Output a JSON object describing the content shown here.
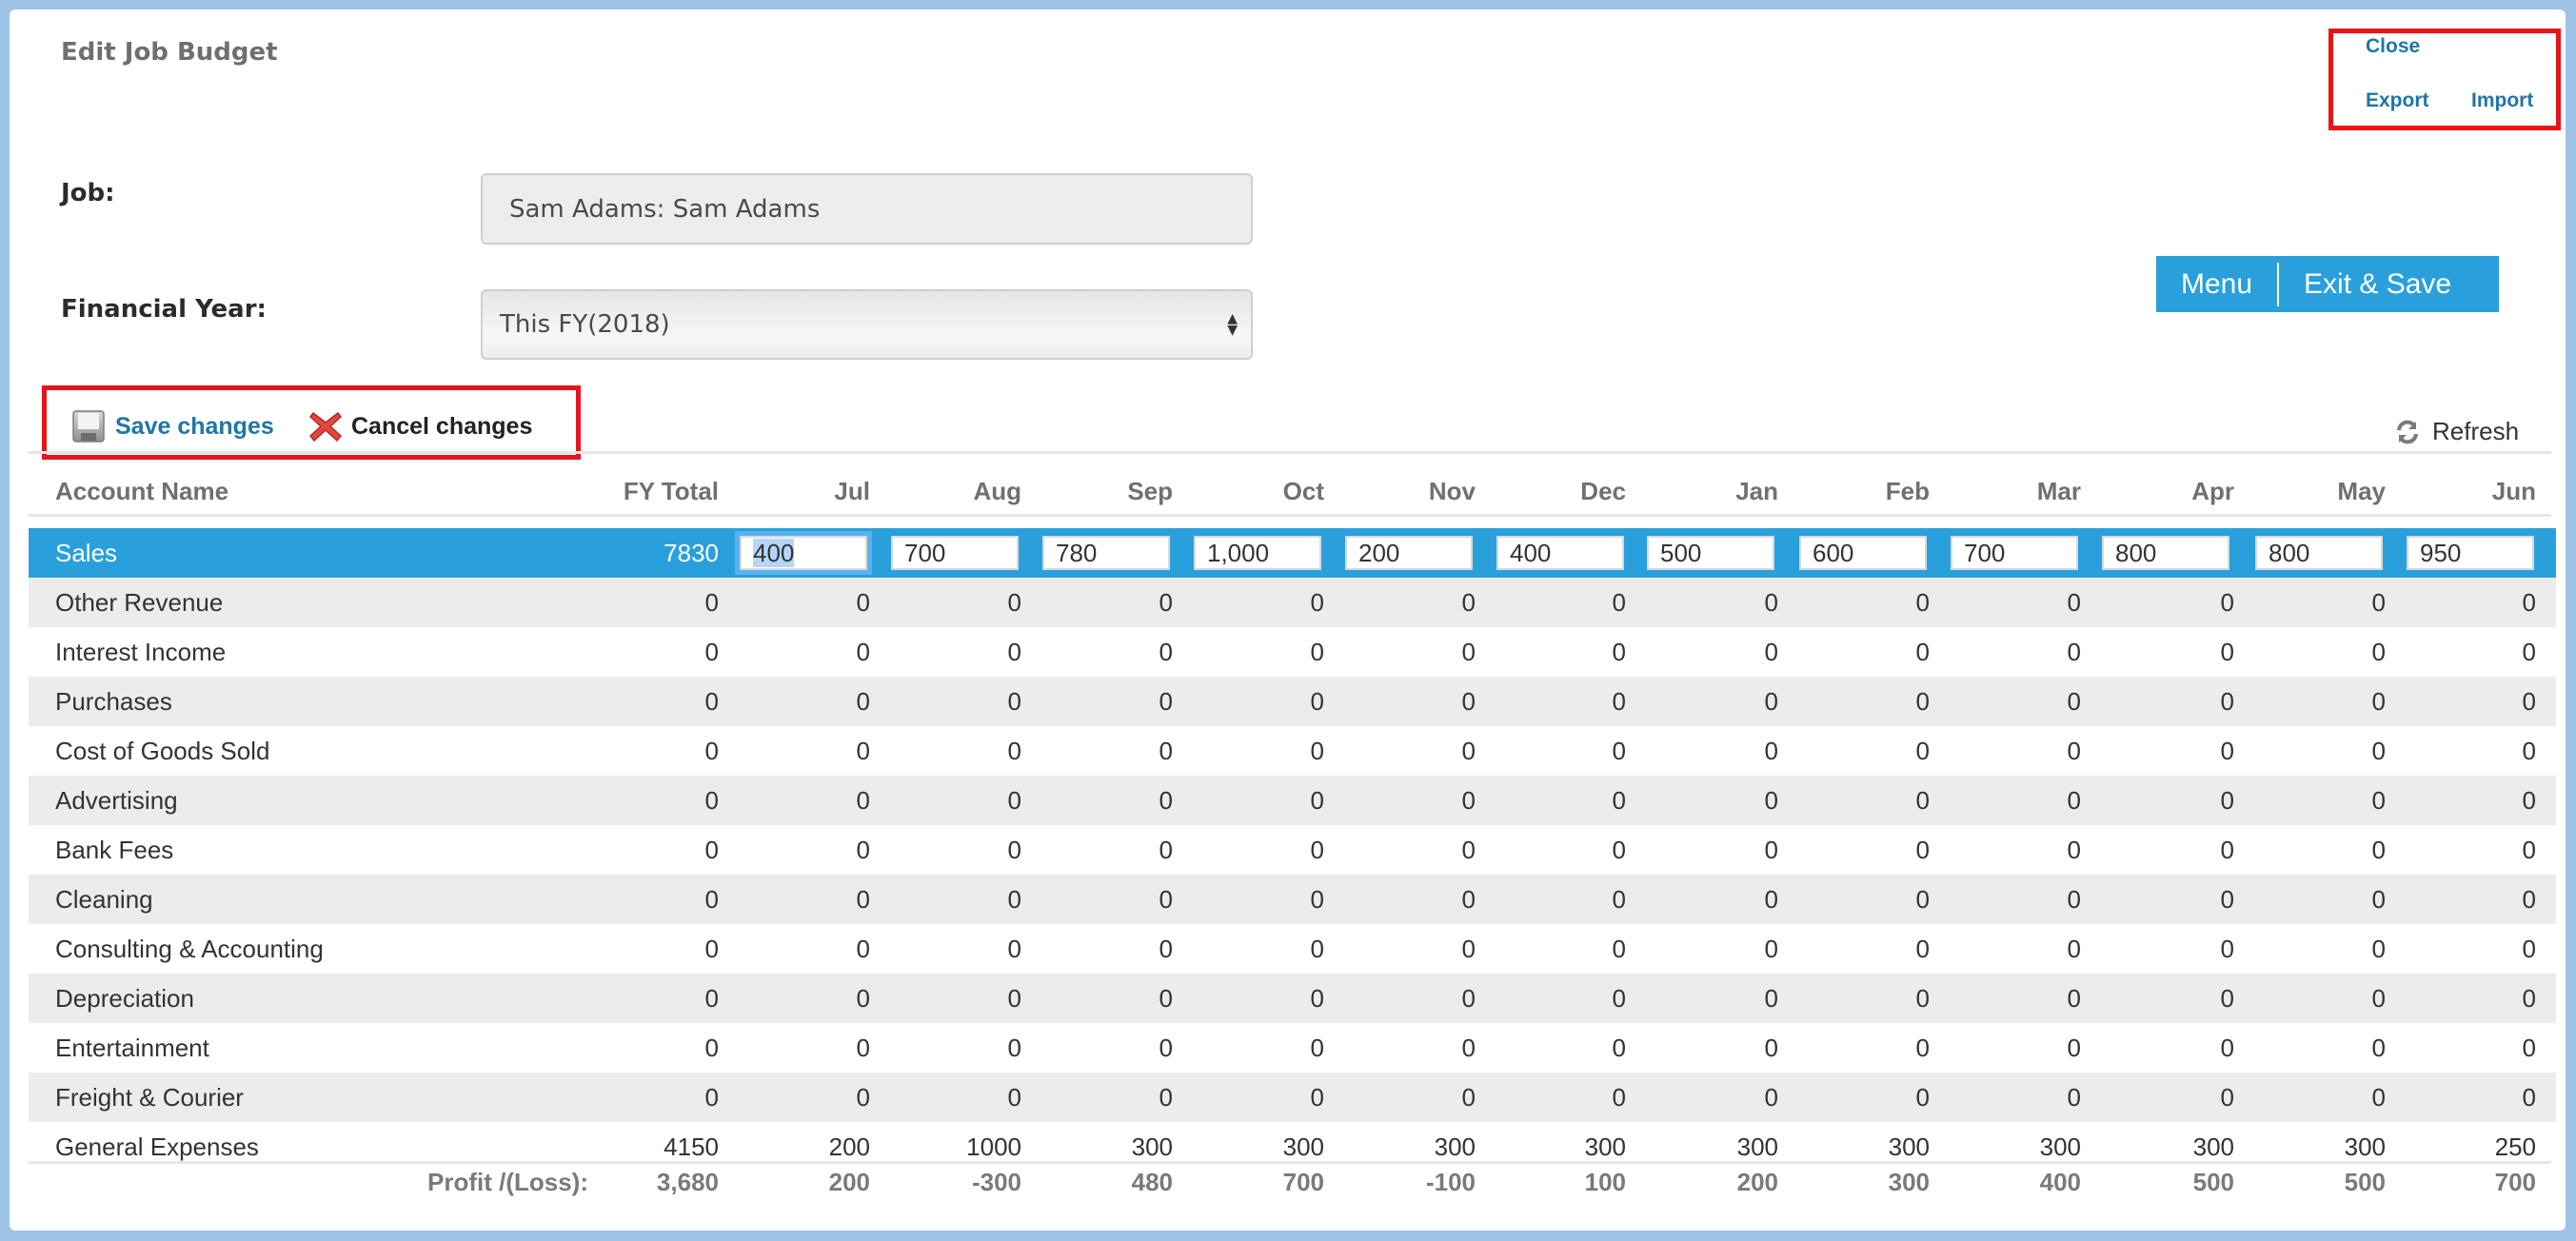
{
  "header": {
    "title": "Edit Job Budget",
    "links": {
      "close": "Close",
      "export": "Export",
      "import": "Import"
    }
  },
  "form": {
    "job_label": "Job:",
    "job_value": "Sam Adams: Sam Adams",
    "fy_label": "Financial Year:",
    "fy_selected": "This FY(2018)"
  },
  "buttons": {
    "menu": "Menu",
    "exit_save": "Exit & Save"
  },
  "toolbar": {
    "save": "Save changes",
    "cancel": "Cancel changes",
    "refresh": "Refresh",
    "icons": {
      "save": "floppy-disk-icon",
      "cancel": "red-x-icon",
      "refresh": "refresh-icon"
    }
  },
  "colors": {
    "accent": "#29a0db",
    "link": "#1f76a5",
    "highlight_box": "#e8141a",
    "frame": "#9dc3e6"
  },
  "table": {
    "columns": [
      "Account Name",
      "FY Total",
      "Jul",
      "Aug",
      "Sep",
      "Oct",
      "Nov",
      "Dec",
      "Jan",
      "Feb",
      "Mar",
      "Apr",
      "May",
      "Jun"
    ],
    "selected_row": "Sales",
    "rows": [
      {
        "name": "Sales",
        "total": "7830",
        "months": [
          "400",
          "700",
          "780",
          "1,000",
          "200",
          "400",
          "500",
          "600",
          "700",
          "800",
          "800",
          "950"
        ],
        "editable": true
      },
      {
        "name": "Other Revenue",
        "total": "0",
        "months": [
          "0",
          "0",
          "0",
          "0",
          "0",
          "0",
          "0",
          "0",
          "0",
          "0",
          "0",
          "0"
        ]
      },
      {
        "name": "Interest Income",
        "total": "0",
        "months": [
          "0",
          "0",
          "0",
          "0",
          "0",
          "0",
          "0",
          "0",
          "0",
          "0",
          "0",
          "0"
        ]
      },
      {
        "name": "Purchases",
        "total": "0",
        "months": [
          "0",
          "0",
          "0",
          "0",
          "0",
          "0",
          "0",
          "0",
          "0",
          "0",
          "0",
          "0"
        ]
      },
      {
        "name": "Cost of Goods Sold",
        "total": "0",
        "months": [
          "0",
          "0",
          "0",
          "0",
          "0",
          "0",
          "0",
          "0",
          "0",
          "0",
          "0",
          "0"
        ]
      },
      {
        "name": "Advertising",
        "total": "0",
        "months": [
          "0",
          "0",
          "0",
          "0",
          "0",
          "0",
          "0",
          "0",
          "0",
          "0",
          "0",
          "0"
        ]
      },
      {
        "name": "Bank Fees",
        "total": "0",
        "months": [
          "0",
          "0",
          "0",
          "0",
          "0",
          "0",
          "0",
          "0",
          "0",
          "0",
          "0",
          "0"
        ]
      },
      {
        "name": "Cleaning",
        "total": "0",
        "months": [
          "0",
          "0",
          "0",
          "0",
          "0",
          "0",
          "0",
          "0",
          "0",
          "0",
          "0",
          "0"
        ]
      },
      {
        "name": "Consulting & Accounting",
        "total": "0",
        "months": [
          "0",
          "0",
          "0",
          "0",
          "0",
          "0",
          "0",
          "0",
          "0",
          "0",
          "0",
          "0"
        ]
      },
      {
        "name": "Depreciation",
        "total": "0",
        "months": [
          "0",
          "0",
          "0",
          "0",
          "0",
          "0",
          "0",
          "0",
          "0",
          "0",
          "0",
          "0"
        ]
      },
      {
        "name": "Entertainment",
        "total": "0",
        "months": [
          "0",
          "0",
          "0",
          "0",
          "0",
          "0",
          "0",
          "0",
          "0",
          "0",
          "0",
          "0"
        ]
      },
      {
        "name": "Freight & Courier",
        "total": "0",
        "months": [
          "0",
          "0",
          "0",
          "0",
          "0",
          "0",
          "0",
          "0",
          "0",
          "0",
          "0",
          "0"
        ]
      },
      {
        "name": "General Expenses",
        "total": "4150",
        "months": [
          "200",
          "1000",
          "300",
          "300",
          "300",
          "300",
          "300",
          "300",
          "300",
          "300",
          "300",
          "250"
        ]
      }
    ],
    "profit": {
      "label": "Profit /(Loss):",
      "total": "3,680",
      "months": [
        "200",
        "-300",
        "480",
        "700",
        "-100",
        "100",
        "200",
        "300",
        "400",
        "500",
        "500",
        "700"
      ]
    }
  }
}
